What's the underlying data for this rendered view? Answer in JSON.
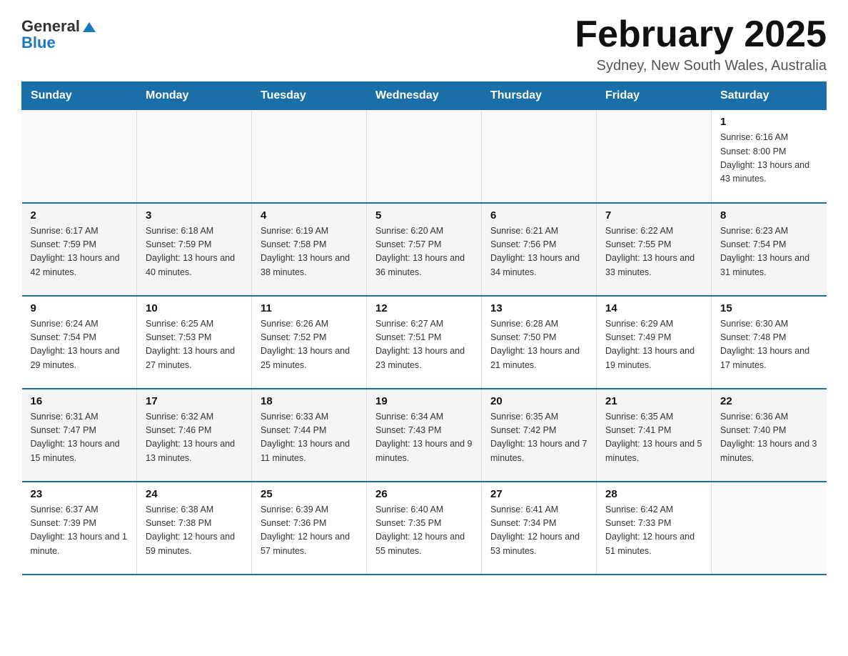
{
  "logo": {
    "general": "General",
    "blue": "Blue"
  },
  "title": "February 2025",
  "subtitle": "Sydney, New South Wales, Australia",
  "days_header": [
    "Sunday",
    "Monday",
    "Tuesday",
    "Wednesday",
    "Thursday",
    "Friday",
    "Saturday"
  ],
  "weeks": [
    [
      {
        "day": "",
        "info": ""
      },
      {
        "day": "",
        "info": ""
      },
      {
        "day": "",
        "info": ""
      },
      {
        "day": "",
        "info": ""
      },
      {
        "day": "",
        "info": ""
      },
      {
        "day": "",
        "info": ""
      },
      {
        "day": "1",
        "info": "Sunrise: 6:16 AM\nSunset: 8:00 PM\nDaylight: 13 hours and 43 minutes."
      }
    ],
    [
      {
        "day": "2",
        "info": "Sunrise: 6:17 AM\nSunset: 7:59 PM\nDaylight: 13 hours and 42 minutes."
      },
      {
        "day": "3",
        "info": "Sunrise: 6:18 AM\nSunset: 7:59 PM\nDaylight: 13 hours and 40 minutes."
      },
      {
        "day": "4",
        "info": "Sunrise: 6:19 AM\nSunset: 7:58 PM\nDaylight: 13 hours and 38 minutes."
      },
      {
        "day": "5",
        "info": "Sunrise: 6:20 AM\nSunset: 7:57 PM\nDaylight: 13 hours and 36 minutes."
      },
      {
        "day": "6",
        "info": "Sunrise: 6:21 AM\nSunset: 7:56 PM\nDaylight: 13 hours and 34 minutes."
      },
      {
        "day": "7",
        "info": "Sunrise: 6:22 AM\nSunset: 7:55 PM\nDaylight: 13 hours and 33 minutes."
      },
      {
        "day": "8",
        "info": "Sunrise: 6:23 AM\nSunset: 7:54 PM\nDaylight: 13 hours and 31 minutes."
      }
    ],
    [
      {
        "day": "9",
        "info": "Sunrise: 6:24 AM\nSunset: 7:54 PM\nDaylight: 13 hours and 29 minutes."
      },
      {
        "day": "10",
        "info": "Sunrise: 6:25 AM\nSunset: 7:53 PM\nDaylight: 13 hours and 27 minutes."
      },
      {
        "day": "11",
        "info": "Sunrise: 6:26 AM\nSunset: 7:52 PM\nDaylight: 13 hours and 25 minutes."
      },
      {
        "day": "12",
        "info": "Sunrise: 6:27 AM\nSunset: 7:51 PM\nDaylight: 13 hours and 23 minutes."
      },
      {
        "day": "13",
        "info": "Sunrise: 6:28 AM\nSunset: 7:50 PM\nDaylight: 13 hours and 21 minutes."
      },
      {
        "day": "14",
        "info": "Sunrise: 6:29 AM\nSunset: 7:49 PM\nDaylight: 13 hours and 19 minutes."
      },
      {
        "day": "15",
        "info": "Sunrise: 6:30 AM\nSunset: 7:48 PM\nDaylight: 13 hours and 17 minutes."
      }
    ],
    [
      {
        "day": "16",
        "info": "Sunrise: 6:31 AM\nSunset: 7:47 PM\nDaylight: 13 hours and 15 minutes."
      },
      {
        "day": "17",
        "info": "Sunrise: 6:32 AM\nSunset: 7:46 PM\nDaylight: 13 hours and 13 minutes."
      },
      {
        "day": "18",
        "info": "Sunrise: 6:33 AM\nSunset: 7:44 PM\nDaylight: 13 hours and 11 minutes."
      },
      {
        "day": "19",
        "info": "Sunrise: 6:34 AM\nSunset: 7:43 PM\nDaylight: 13 hours and 9 minutes."
      },
      {
        "day": "20",
        "info": "Sunrise: 6:35 AM\nSunset: 7:42 PM\nDaylight: 13 hours and 7 minutes."
      },
      {
        "day": "21",
        "info": "Sunrise: 6:35 AM\nSunset: 7:41 PM\nDaylight: 13 hours and 5 minutes."
      },
      {
        "day": "22",
        "info": "Sunrise: 6:36 AM\nSunset: 7:40 PM\nDaylight: 13 hours and 3 minutes."
      }
    ],
    [
      {
        "day": "23",
        "info": "Sunrise: 6:37 AM\nSunset: 7:39 PM\nDaylight: 13 hours and 1 minute."
      },
      {
        "day": "24",
        "info": "Sunrise: 6:38 AM\nSunset: 7:38 PM\nDaylight: 12 hours and 59 minutes."
      },
      {
        "day": "25",
        "info": "Sunrise: 6:39 AM\nSunset: 7:36 PM\nDaylight: 12 hours and 57 minutes."
      },
      {
        "day": "26",
        "info": "Sunrise: 6:40 AM\nSunset: 7:35 PM\nDaylight: 12 hours and 55 minutes."
      },
      {
        "day": "27",
        "info": "Sunrise: 6:41 AM\nSunset: 7:34 PM\nDaylight: 12 hours and 53 minutes."
      },
      {
        "day": "28",
        "info": "Sunrise: 6:42 AM\nSunset: 7:33 PM\nDaylight: 12 hours and 51 minutes."
      },
      {
        "day": "",
        "info": ""
      }
    ]
  ]
}
